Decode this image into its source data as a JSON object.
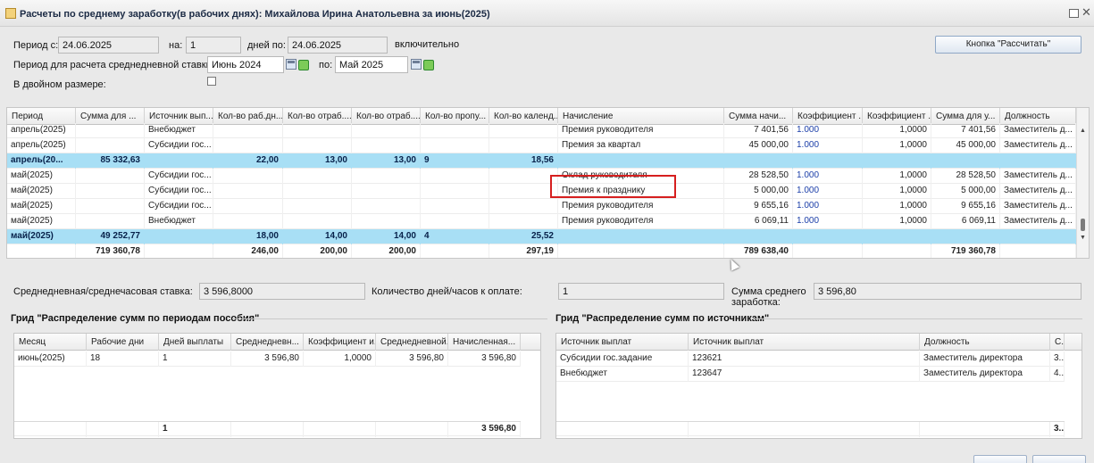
{
  "window": {
    "title": "Расчеты по среднему заработку(в рабочих днях): Михайлова Ирина Анатольевна за июнь(2025)"
  },
  "form": {
    "period_from_label": "Период с:",
    "period_from_value": "24.06.2025",
    "on_label": "на:",
    "on_value": "1",
    "days_to_label": "дней по:",
    "days_to_value": "24.06.2025",
    "inclusive_label": "включительно",
    "avg_period_label": "Период для расчета среднедневной ставки:",
    "avg_from_value": "Июнь 2024",
    "avg_to_label": "по:",
    "avg_to_value": "Май 2025",
    "double_label": "В двойном размере:",
    "calc_button": "Кнопка \"Рассчитать\""
  },
  "main_grid": {
    "columns": [
      "Период",
      "Сумма для ...",
      "Источник вып...",
      "Кол-во раб.дн...",
      "Кол-во отраб....",
      "Кол-во отраб....",
      "Кол-во пропу...",
      "Кол-во календ...",
      "Начисление",
      "Сумма начи...",
      "Коэффициент ...",
      "Коэффициент ...",
      "Сумма для у...",
      "Должность"
    ],
    "rows": [
      {
        "type": "normal",
        "cells": [
          "апрель(2025)",
          "",
          "Внебюджет",
          "",
          "",
          "",
          "",
          "",
          "Премия руководителя",
          "7 401,56",
          "1.000",
          "1,0000",
          "7 401,56",
          "Заместитель д..."
        ]
      },
      {
        "type": "normal",
        "cells": [
          "апрель(2025)",
          "",
          "Субсидии гос...",
          "",
          "",
          "",
          "",
          "",
          "Премия за квартал",
          "45 000,00",
          "1.000",
          "1,0000",
          "45 000,00",
          "Заместитель д..."
        ]
      },
      {
        "type": "group",
        "cells": [
          "апрель(20...",
          "85 332,63",
          "",
          "22,00",
          "13,00",
          "13,00",
          "9",
          "18,56",
          "",
          "",
          "",
          "",
          "",
          ""
        ]
      },
      {
        "type": "normal",
        "cells": [
          "май(2025)",
          "",
          "Субсидии гос...",
          "",
          "",
          "",
          "",
          "",
          "Оклад руководителя",
          "28 528,50",
          "1.000",
          "1,0000",
          "28 528,50",
          "Заместитель д..."
        ]
      },
      {
        "type": "normal",
        "cells": [
          "май(2025)",
          "",
          "Субсидии гос...",
          "",
          "",
          "",
          "",
          "",
          "Премия к празднику",
          "5 000,00",
          "1.000",
          "1,0000",
          "5 000,00",
          "Заместитель д..."
        ]
      },
      {
        "type": "normal",
        "cells": [
          "май(2025)",
          "",
          "Субсидии гос...",
          "",
          "",
          "",
          "",
          "",
          "Премия руководителя",
          "9 655,16",
          "1.000",
          "1,0000",
          "9 655,16",
          "Заместитель д..."
        ]
      },
      {
        "type": "normal",
        "cells": [
          "май(2025)",
          "",
          "Внебюджет",
          "",
          "",
          "",
          "",
          "",
          "Премия руководителя",
          "6 069,11",
          "1.000",
          "1,0000",
          "6 069,11",
          "Заместитель д..."
        ]
      },
      {
        "type": "group",
        "cells": [
          "май(2025)",
          "49 252,77",
          "",
          "18,00",
          "14,00",
          "14,00",
          "4",
          "25,52",
          "",
          "",
          "",
          "",
          "",
          ""
        ]
      },
      {
        "type": "total",
        "cells": [
          "",
          "719 360,78",
          "",
          "246,00",
          "200,00",
          "200,00",
          "",
          "297,19",
          "",
          "789 638,40",
          "",
          "",
          "719 360,78",
          ""
        ]
      }
    ]
  },
  "summary": {
    "rate_label": "Среднедневная/среднечасовая ставка:",
    "rate_value": "3 596,8000",
    "days_label": "Количество дней/часов к оплате:",
    "days_value": "1",
    "avg_sum_label": "Сумма среднего заработка:",
    "avg_sum_value": "3 596,80"
  },
  "periods_grid": {
    "title": "Грид \"Распределение сумм по периодам пособия\"",
    "columns": [
      "Месяц",
      "Рабочие дни",
      "Дней выплаты",
      "Среднедневн...",
      "Коэффициент и...",
      "Среднедневной...",
      "Начисленная..."
    ],
    "rows": [
      [
        "июнь(2025)",
        "18",
        "1",
        "3 596,80",
        "1,0000",
        "3 596,80",
        "3 596,80"
      ]
    ],
    "totals": [
      "",
      "",
      "1",
      "",
      "",
      "",
      "3 596,80"
    ]
  },
  "sources_grid": {
    "title": "Грид \"Распределение сумм по источникам\"",
    "columns": [
      "Источник выплат",
      "Источник выплат",
      "Должность",
      "С..."
    ],
    "rows": [
      [
        "Субсидии гос.задание",
        "123621",
        "Заместитель директора",
        "3..."
      ],
      [
        "Внебюджет",
        "123647",
        "Заместитель директора",
        "4..."
      ]
    ],
    "totals": [
      "",
      "",
      "",
      "3.."
    ]
  },
  "colors": {
    "group_row": "#a8dff5",
    "highlight": "#d61f1f",
    "coef_text": "#1b3ea8"
  }
}
